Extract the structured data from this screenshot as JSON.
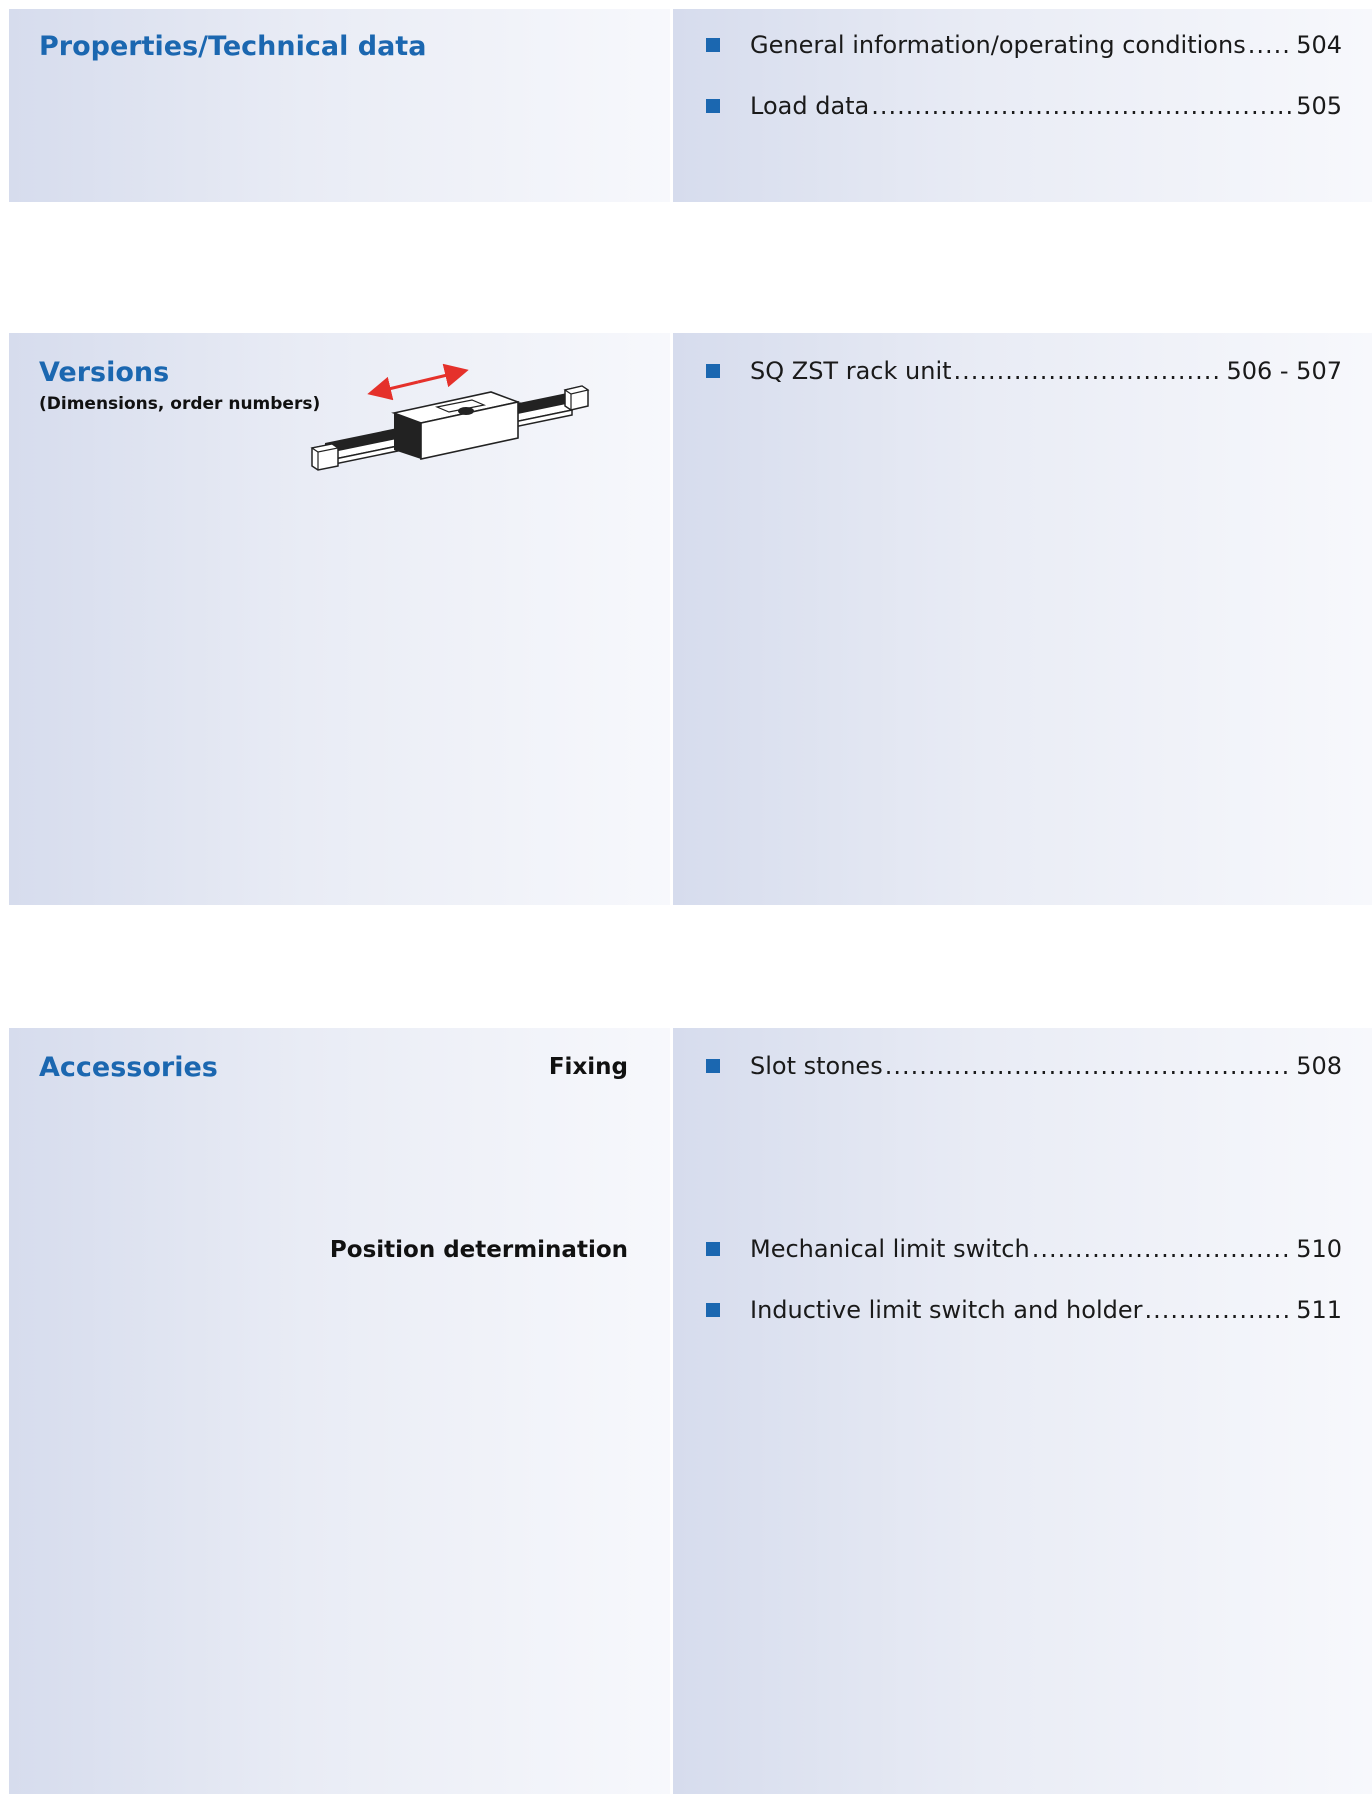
{
  "sections": [
    {
      "title": "Properties/Technical data",
      "items": [
        {
          "label": "General information/operating conditions",
          "page": "504"
        },
        {
          "label": "Load data",
          "page": "505"
        }
      ]
    },
    {
      "title": "Versions",
      "subtitle": "(Dimensions, order numbers)",
      "image_icon": "linear-unit-illustration",
      "items": [
        {
          "label": "SQ ZST rack unit",
          "page": "506 - 507"
        }
      ]
    },
    {
      "title": "Accessories",
      "groups": [
        {
          "label": "Fixing",
          "items": [
            {
              "label": "Slot stones",
              "page": "508"
            }
          ]
        },
        {
          "label": "Position determination",
          "items": [
            {
              "label": "Mechanical limit switch",
              "page": "510"
            },
            {
              "label": "Inductive limit switch and holder",
              "page": "511"
            }
          ]
        }
      ]
    }
  ],
  "colors": {
    "accent": "#1b67b0",
    "arrow": "#e5312b",
    "panel_dark": "#d6dced",
    "panel_light": "#f7f8fc"
  }
}
